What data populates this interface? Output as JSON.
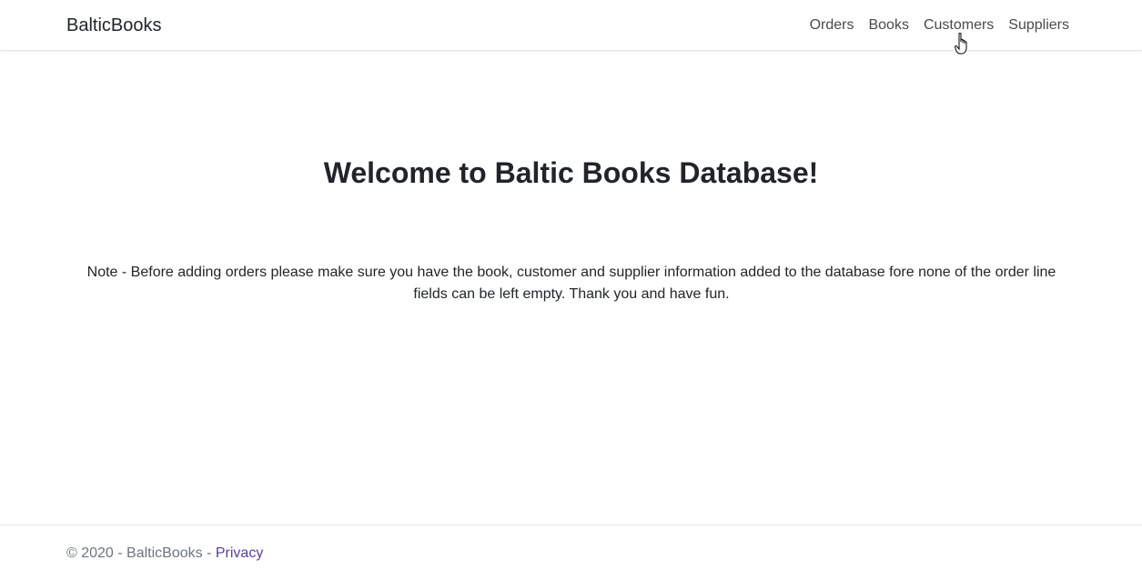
{
  "navbar": {
    "brand": "BalticBooks",
    "links": [
      "Orders",
      "Books",
      "Customers",
      "Suppliers"
    ]
  },
  "main": {
    "title": "Welcome to Baltic Books Database!",
    "note": "Note - Before adding orders please make sure you have the book, customer and supplier information added to the database fore none of the order line fields can be left empty. Thank you and have fun."
  },
  "footer": {
    "copyright": "© 2020 - BalticBooks - ",
    "privacy_link": "Privacy"
  },
  "colors": {
    "link_purple": "#5a3e9c",
    "text_dark": "#212529",
    "muted": "#6c757d"
  },
  "cursor": "hand-pointer-icon"
}
